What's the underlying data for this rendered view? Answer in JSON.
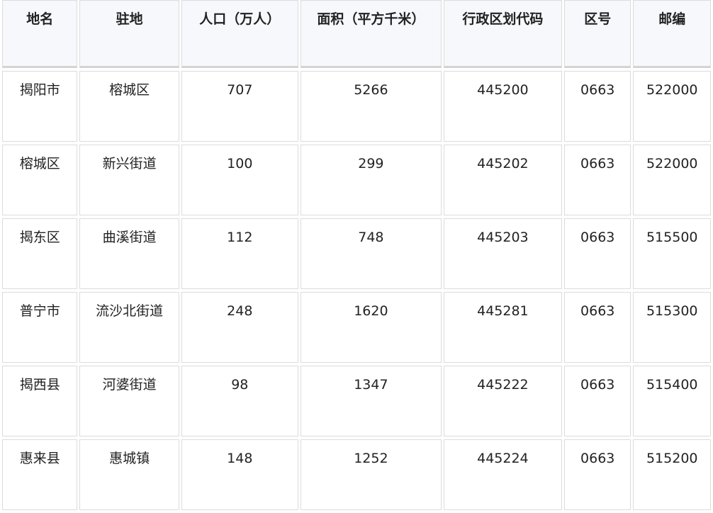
{
  "headers": [
    "地名",
    "驻地",
    "人口（万人）",
    "面积（平方千米）",
    "行政区划代码",
    "区号",
    "邮编"
  ],
  "rows": [
    [
      "揭阳市",
      "榕城区",
      "707",
      "5266",
      "445200",
      "0663",
      "522000"
    ],
    [
      "榕城区",
      "新兴街道",
      "100",
      "299",
      "445202",
      "0663",
      "522000"
    ],
    [
      "揭东区",
      "曲溪街道",
      "112",
      "748",
      "445203",
      "0663",
      "515500"
    ],
    [
      "普宁市",
      "流沙北街道",
      "248",
      "1620",
      "445281",
      "0663",
      "515300"
    ],
    [
      "揭西县",
      "河婆街道",
      "98",
      "1347",
      "445222",
      "0663",
      "515400"
    ],
    [
      "惠来县",
      "惠城镇",
      "148",
      "1252",
      "445224",
      "0663",
      "515200"
    ]
  ]
}
